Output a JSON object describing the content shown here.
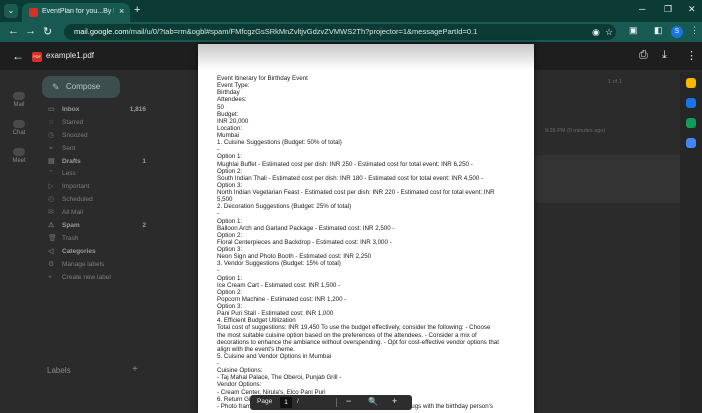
{
  "browser": {
    "tab_title": "EventPlan for you...By FusionE...",
    "tab_close": "×",
    "new_tab": "+",
    "url_host": "mail.google.com",
    "url_rest": "/mail/u/0/?tab=rm&ogbl#spam/FMfcgzGsSRkMnZvltjvGdzvZVMWS2Th?projector=1&messagePartId=0.1",
    "profile_initial": "S"
  },
  "viewer": {
    "filename": "example1.pdf",
    "page_label": "Page",
    "current_page": "1",
    "page_sep": "/",
    "page_total": "",
    "zoom_out": "−",
    "zoom_in": "+"
  },
  "gmail_bg": {
    "rail": [
      {
        "label": "Mail"
      },
      {
        "label": "Chat"
      },
      {
        "label": "Meet"
      }
    ],
    "compose_label": "Compose",
    "nav": [
      {
        "label": "Inbox",
        "count": "1,816",
        "bold": true
      },
      {
        "label": "Starred",
        "count": "",
        "bold": false
      },
      {
        "label": "Snoozed",
        "count": "",
        "bold": false
      },
      {
        "label": "Sent",
        "count": "",
        "bold": false
      },
      {
        "label": "Drafts",
        "count": "1",
        "bold": true
      },
      {
        "label": "Less",
        "count": "",
        "bold": false
      },
      {
        "label": "Important",
        "count": "",
        "bold": false
      },
      {
        "label": "Scheduled",
        "count": "",
        "bold": false
      },
      {
        "label": "All Mail",
        "count": "",
        "bold": false
      },
      {
        "label": "Spam",
        "count": "2",
        "bold": true
      },
      {
        "label": "Trash",
        "count": "",
        "bold": false
      },
      {
        "label": "Categories",
        "count": "",
        "bold": true
      },
      {
        "label": "Manage labels",
        "count": "",
        "bold": false
      },
      {
        "label": "Create new label",
        "count": "",
        "bold": false
      }
    ],
    "labels_heading": "Labels",
    "page_count": "1 of 1",
    "mail_time": "9:26 PM (0 minutes ago)"
  },
  "document": {
    "lines": [
      "Event Itinerary for Birthday Event",
      "Event Type:",
      "Birthday",
      "Attendees:",
      "50",
      "Budget:",
      "INR 20,000",
      "Location:",
      "Mumbai",
      "1. Cuisine Suggestions (Budget: 50% of total)",
      "-",
      "Option 1:",
      "Mughlai Buffet - Estimated cost per dish: INR 250 - Estimated cost for total event: INR 6,250 -",
      "Option 2:",
      "South Indian Thali - Estimated cost per dish: INR 180 - Estimated cost for total event: INR 4,500 -",
      "Option 3:",
      "North Indian Vegetarian Feast - Estimated cost per dish: INR 220 - Estimated cost for total event: INR",
      "5,500",
      "2. Decoration Suggestions (Budget: 25% of total)",
      "-",
      "Option 1:",
      "Balloon Arch and Garland Package - Estimated cost: INR 2,500 -",
      "Option 2:",
      "Floral Centerpieces and Backdrop - Estimated cost: INR 3,000 -",
      "Option 3:",
      "Neon Sign and Photo Booth - Estimated cost: INR 2,250",
      "3. Vendor Suggestions (Budget: 15% of total)",
      "-",
      "Option 1:",
      "Ice Cream Cart - Estimated cost: INR 1,500 -",
      "Option 2:",
      "Popcorn Machine - Estimated cost: INR 1,200 -",
      "Option 3:",
      "Pani Puri Stall - Estimated cost: INR 1,000",
      "4. Efficient Budget Utilization",
      "Total cost of suggestions: INR 19,450 To use the budget effectively, consider the following: - Choose",
      "the most suitable cuisine option based on the preferences of the attendees. - Consider a mix of",
      "decorations to enhance the ambiance without overspending. - Opt for cost-effective vendor options that",
      "align with the event's theme.",
      "5. Cuisine and Vendor Options in Mumbai",
      "-",
      "Cuisine Options:",
      "- Taj Mahal Palace, The Oberoi, Punjab Grill -",
      "Vendor Options:",
      "- Cream Center, Nirula's, Elco Pani Puri",
      "6. Return Gift Suggestions (B",
      "- Photo frames with personalized message (INR 500 each) - Custom mugs with the birthday person's"
    ]
  }
}
